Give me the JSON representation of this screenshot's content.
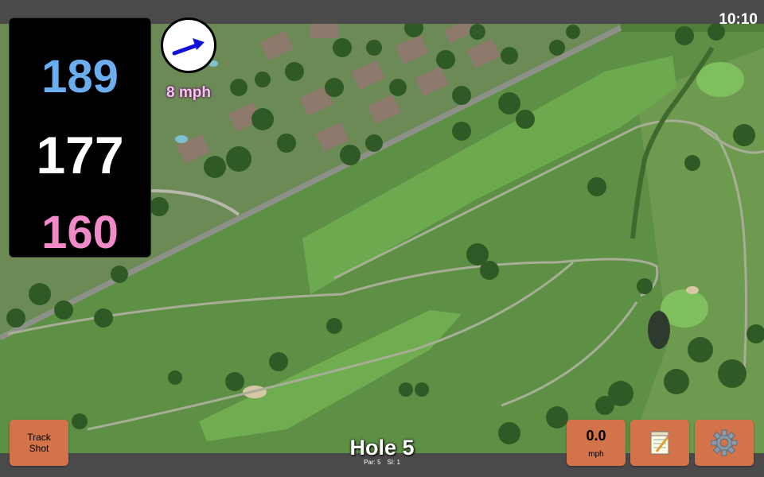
{
  "status": {
    "time": "10:10"
  },
  "distances": {
    "back": "189",
    "middle": "177",
    "front": "160"
  },
  "wind": {
    "speed_label": "8 mph",
    "direction_icon": "wind-arrow-icon"
  },
  "hole": {
    "title": "Hole 5",
    "par": "Par: 5",
    "si": "SI: 1"
  },
  "buttons": {
    "track_shot": "Track Shot",
    "wind_value": "0.0",
    "wind_unit": "mph",
    "notes_icon": "notepad-icon",
    "settings_icon": "gear-icon"
  },
  "colors": {
    "back_distance": "#6aaef0",
    "middle_distance": "#ffffff",
    "front_distance": "#f08ac8",
    "button": "#d2734a",
    "wind_arrow": "#1010d8"
  }
}
